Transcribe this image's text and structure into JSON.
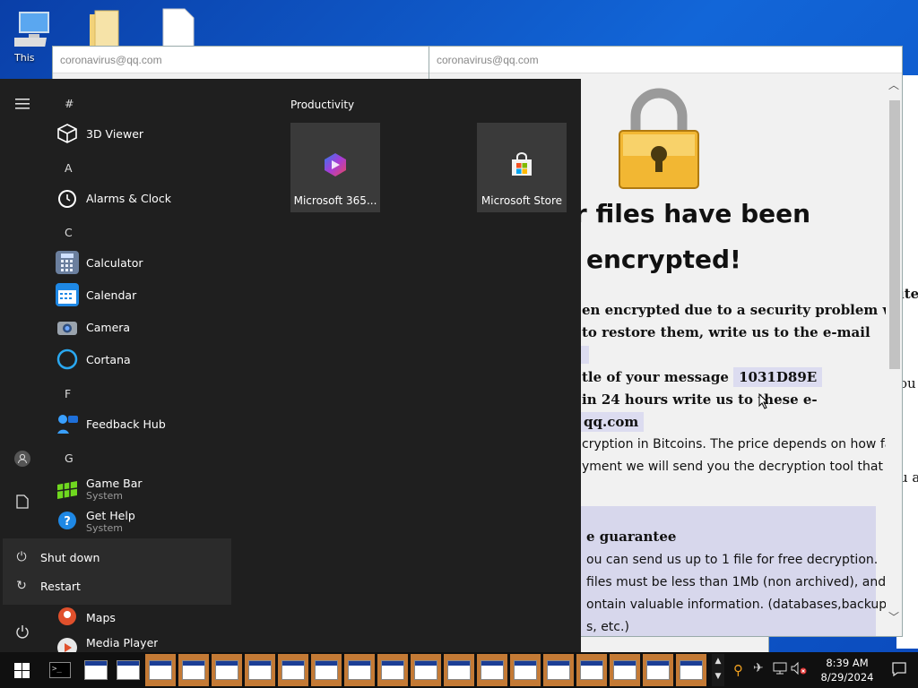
{
  "desktop": {
    "icons": [
      {
        "name": "this-pc-icon",
        "label": "This"
      },
      {
        "name": "folder-icon",
        "label": ""
      },
      {
        "name": "document-icon",
        "label": ""
      }
    ]
  },
  "ransom_window_back": {
    "title": "coronavirus@qq.com"
  },
  "ransom_window": {
    "title": "coronavirus@qq.com",
    "heading_line1": "ur files have been",
    "heading_line2": "encrypted!",
    "p1": "en encrypted due to a security problem with",
    "p2": "to restore them, write us to the e-mail",
    "p3_prefix": "tle of your message",
    "message_id": "1031D89E",
    "p4": "in 24 hours write us to these e-",
    "p5_email": "qq.com",
    "p6": "cryption in Bitcoins. The price depends on how fast",
    "p7": "yment we will send you the decryption tool that",
    "guarantee_title": "e guarantee",
    "g1": "ou can send us up to 1 file for free decryption.",
    "g2": "files must be less than 1Mb (non archived), and",
    "g3": "ontain valuable information. (databases,backups,",
    "g4": "s, etc.)",
    "back_fragments": [
      "ite",
      "ou",
      "u ar"
    ]
  },
  "start_menu": {
    "letters": [
      "#",
      "A",
      "C",
      "F",
      "G"
    ],
    "apps": [
      {
        "name": "3D Viewer"
      },
      {
        "name": "Alarms & Clock"
      },
      {
        "name": "Calculator"
      },
      {
        "name": "Calendar"
      },
      {
        "name": "Camera"
      },
      {
        "name": "Cortana"
      },
      {
        "name": "Feedback Hub"
      },
      {
        "name": "Game Bar",
        "sub": "System"
      },
      {
        "name": "Get Help",
        "sub": "System"
      },
      {
        "name": "Maps"
      },
      {
        "name": "Media Player"
      }
    ],
    "section_title": "Productivity",
    "tiles": [
      {
        "name": "Microsoft 365..."
      },
      {
        "name": "Microsoft Store"
      }
    ],
    "power_menu": {
      "shutdown": "Shut down",
      "restart": "Restart"
    }
  },
  "taskbar": {
    "time": "8:39 AM",
    "date": "8/29/2024"
  },
  "colors": {
    "accent": "#c47a35",
    "start_bg": "#1f1f1f",
    "highlight": "#dcdcf0"
  }
}
